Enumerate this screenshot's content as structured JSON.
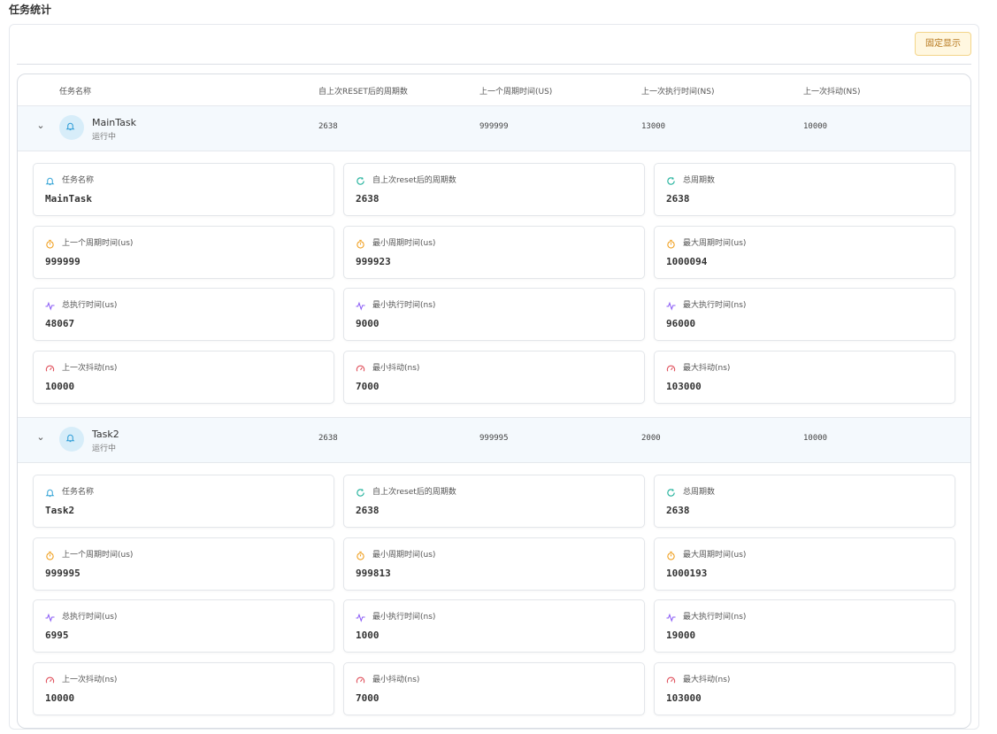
{
  "page": {
    "title": "任务统计",
    "pin_label": "固定显示"
  },
  "table": {
    "headers": [
      "任务名称",
      "自上次RESET后的周期数",
      "上一个周期时间(US)",
      "上一次执行时间(NS)",
      "上一次抖动(NS)"
    ]
  },
  "tasks": [
    {
      "name": "MainTask",
      "status": "运行中",
      "row": [
        "2638",
        "999999",
        "13000",
        "10000"
      ],
      "details": [
        {
          "icon": "bell-icon",
          "color": "#33a3d6",
          "label": "任务名称",
          "value": "MainTask"
        },
        {
          "icon": "refresh-icon",
          "color": "#2bb5a0",
          "label": "自上次reset后的周期数",
          "value": "2638"
        },
        {
          "icon": "refresh-icon",
          "color": "#2bb5a0",
          "label": "总周期数",
          "value": "2638"
        },
        {
          "icon": "stopwatch-icon",
          "color": "#f0a020",
          "label": "上一个周期时间(us)",
          "value": "999999"
        },
        {
          "icon": "stopwatch-icon",
          "color": "#f0a020",
          "label": "最小周期时间(us)",
          "value": "999923"
        },
        {
          "icon": "stopwatch-icon",
          "color": "#f0a020",
          "label": "最大周期时间(us)",
          "value": "1000094"
        },
        {
          "icon": "pulse-icon",
          "color": "#8b5cf6",
          "label": "总执行时间(us)",
          "value": "48067"
        },
        {
          "icon": "pulse-icon",
          "color": "#8b5cf6",
          "label": "最小执行时间(ns)",
          "value": "9000"
        },
        {
          "icon": "pulse-icon",
          "color": "#8b5cf6",
          "label": "最大执行时间(ns)",
          "value": "96000"
        },
        {
          "icon": "gauge-icon",
          "color": "#e0525e",
          "label": "上一次抖动(ns)",
          "value": "10000"
        },
        {
          "icon": "gauge-icon",
          "color": "#e0525e",
          "label": "最小抖动(ns)",
          "value": "7000"
        },
        {
          "icon": "gauge-icon",
          "color": "#e0525e",
          "label": "最大抖动(ns)",
          "value": "103000"
        }
      ]
    },
    {
      "name": "Task2",
      "status": "运行中",
      "row": [
        "2638",
        "999995",
        "2000",
        "10000"
      ],
      "details": [
        {
          "icon": "bell-icon",
          "color": "#33a3d6",
          "label": "任务名称",
          "value": "Task2"
        },
        {
          "icon": "refresh-icon",
          "color": "#2bb5a0",
          "label": "自上次reset后的周期数",
          "value": "2638"
        },
        {
          "icon": "refresh-icon",
          "color": "#2bb5a0",
          "label": "总周期数",
          "value": "2638"
        },
        {
          "icon": "stopwatch-icon",
          "color": "#f0a020",
          "label": "上一个周期时间(us)",
          "value": "999995"
        },
        {
          "icon": "stopwatch-icon",
          "color": "#f0a020",
          "label": "最小周期时间(us)",
          "value": "999813"
        },
        {
          "icon": "stopwatch-icon",
          "color": "#f0a020",
          "label": "最大周期时间(us)",
          "value": "1000193"
        },
        {
          "icon": "pulse-icon",
          "color": "#8b5cf6",
          "label": "总执行时间(us)",
          "value": "6995"
        },
        {
          "icon": "pulse-icon",
          "color": "#8b5cf6",
          "label": "最小执行时间(ns)",
          "value": "1000"
        },
        {
          "icon": "pulse-icon",
          "color": "#8b5cf6",
          "label": "最大执行时间(ns)",
          "value": "19000"
        },
        {
          "icon": "gauge-icon",
          "color": "#e0525e",
          "label": "上一次抖动(ns)",
          "value": "10000"
        },
        {
          "icon": "gauge-icon",
          "color": "#e0525e",
          "label": "最小抖动(ns)",
          "value": "7000"
        },
        {
          "icon": "gauge-icon",
          "color": "#e0525e",
          "label": "最大抖动(ns)",
          "value": "103000"
        }
      ]
    }
  ]
}
